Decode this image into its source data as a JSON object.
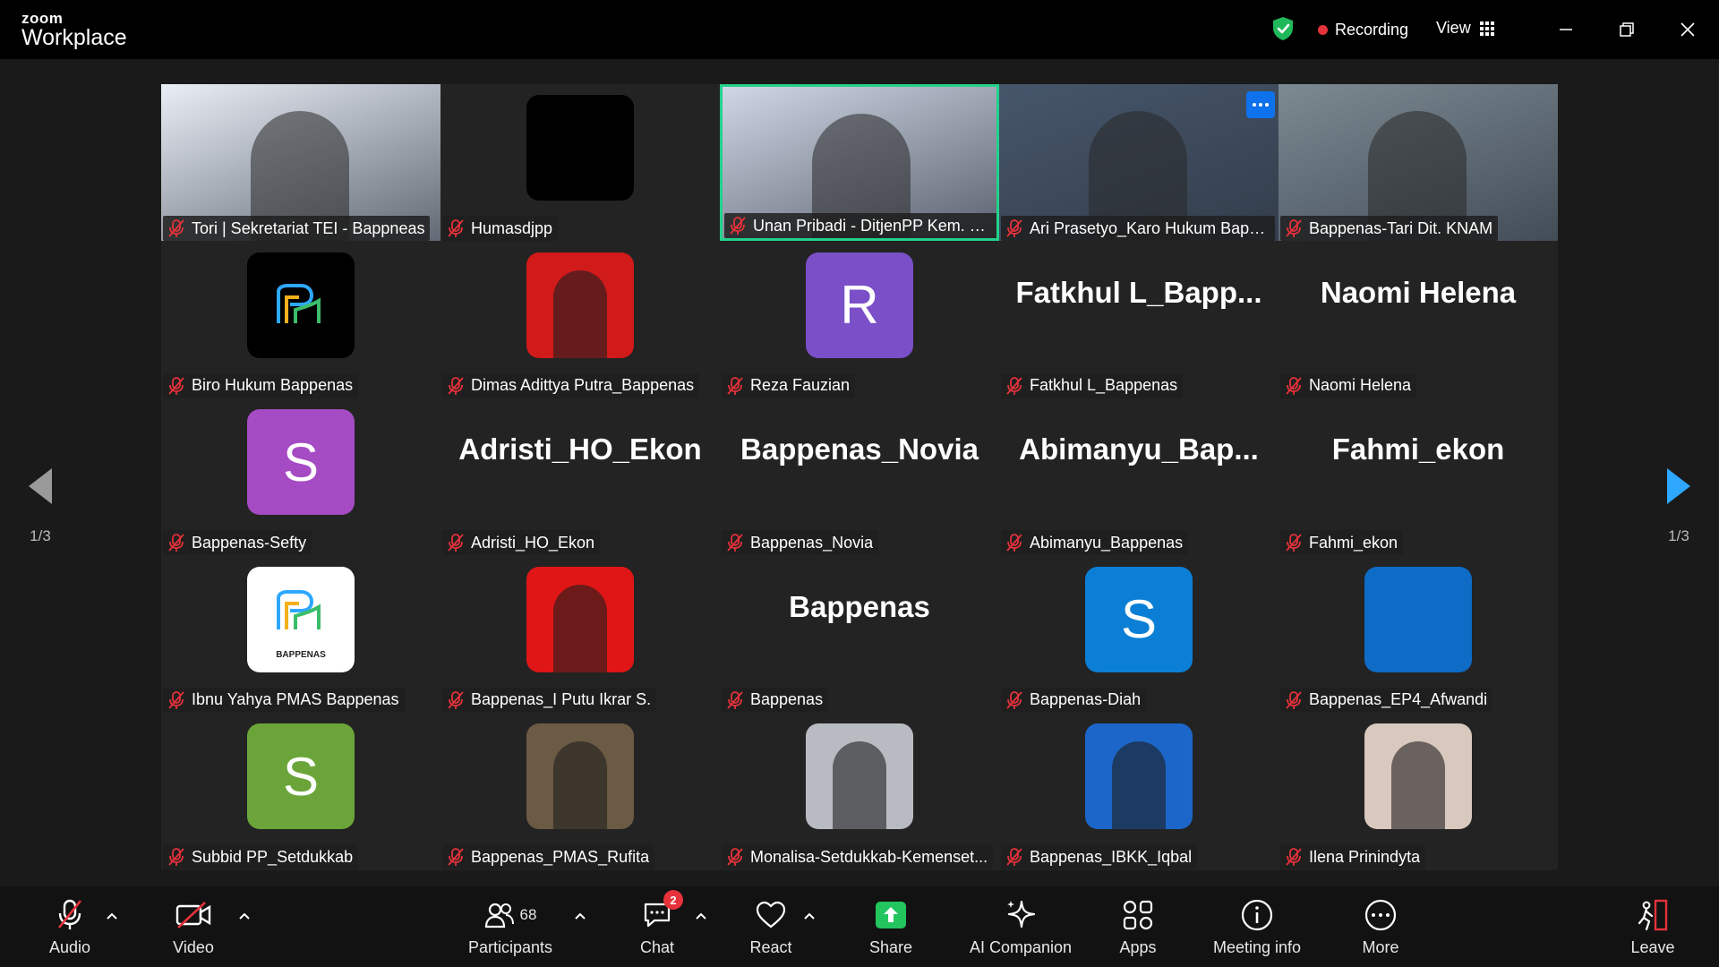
{
  "app": {
    "brand_top": "zoom",
    "brand_bottom": "Workplace"
  },
  "header": {
    "recording_label": "Recording",
    "view_label": "View"
  },
  "pagination": {
    "left": "1/3",
    "right": "1/3"
  },
  "participants": [
    {
      "name": "Tori | Sekretariat TEI - Bappneas",
      "type": "video",
      "bg": "#e9eef6"
    },
    {
      "name": "Humasdjpp",
      "type": "avatar",
      "color": "#000000",
      "letter": ""
    },
    {
      "name": "Unan Pribadi - DitjenPP Kem. Huk...",
      "type": "video",
      "bg": "#cfd7e6",
      "active": true
    },
    {
      "name": "Ari Prasetyo_Karo Hukum Bapp...",
      "type": "video",
      "bg": "#46566a"
    },
    {
      "name": "Bappenas-Tari Dit. KNAM",
      "type": "video",
      "bg": "#7c8a92"
    },
    {
      "name": "Biro Hukum Bappenas",
      "type": "avatar",
      "color": "#000000",
      "letter": "",
      "logo": true
    },
    {
      "name": "Dimas Adittya Putra_Bappenas",
      "type": "avatar",
      "color": "#d11a1a",
      "letter": "",
      "photo": true
    },
    {
      "name": "Reza Fauzian",
      "type": "avatar",
      "color": "#7a4fc7",
      "letter": "R"
    },
    {
      "name": "Fatkhul L_Bappenas",
      "type": "text",
      "bigname": "Fatkhul  L_Bapp..."
    },
    {
      "name": "Naomi Helena",
      "type": "text",
      "bigname": "Naomi Helena"
    },
    {
      "name": "Bappenas-Sefty",
      "type": "avatar",
      "color": "#a54bc3",
      "letter": "S"
    },
    {
      "name": "Adristi_HO_Ekon",
      "type": "text",
      "bigname": "Adristi_HO_Ekon"
    },
    {
      "name": "Bappenas_Novia",
      "type": "text",
      "bigname": "Bappenas_Novia"
    },
    {
      "name": "Abimanyu_Bappenas",
      "type": "text",
      "bigname": "Abimanyu_Bap..."
    },
    {
      "name": "Fahmi_ekon",
      "type": "text",
      "bigname": "Fahmi_ekon"
    },
    {
      "name": "Ibnu Yahya PMAS Bappenas",
      "type": "avatar",
      "color": "#ffffff",
      "letter": "",
      "logo": true,
      "logo_text": "BAPPENAS"
    },
    {
      "name": "Bappenas_I Putu Ikrar S.",
      "type": "avatar",
      "color": "#e01616",
      "letter": "",
      "photo": true
    },
    {
      "name": "Bappenas",
      "type": "text",
      "bigname": "Bappenas"
    },
    {
      "name": "Bappenas-Diah",
      "type": "avatar",
      "color": "#0b7fd6",
      "letter": "S"
    },
    {
      "name": "Bappenas_EP4_Afwandi",
      "type": "avatar",
      "color": "#0e6bc6",
      "letter": ""
    },
    {
      "name": "Subbid PP_Setdukkab",
      "type": "avatar",
      "color": "#6ba53a",
      "letter": "S"
    },
    {
      "name": "Bappenas_PMAS_Rufita",
      "type": "avatar",
      "color": "#6b5a44",
      "letter": "",
      "photo": true
    },
    {
      "name": "Monalisa-Setdukkab-Kemenset...",
      "type": "avatar",
      "color": "#b8bcc2",
      "letter": "",
      "photo": true
    },
    {
      "name": "Bappenas_IBKK_Iqbal",
      "type": "avatar",
      "color": "#1c66c9",
      "letter": "",
      "photo": true
    },
    {
      "name": "Ilena Prinindyta",
      "type": "avatar",
      "color": "#d9c8bd",
      "letter": "",
      "photo": true
    }
  ],
  "toolbar": {
    "audio": "Audio",
    "video": "Video",
    "participants": "Participants",
    "participants_count": "68",
    "chat": "Chat",
    "chat_badge": "2",
    "react": "React",
    "share": "Share",
    "ai": "AI Companion",
    "apps": "Apps",
    "info": "Meeting info",
    "more": "More",
    "leave": "Leave"
  },
  "colors": {
    "share": "#23c55e",
    "active_border": "#23d18b",
    "recording_dot": "#e5323b",
    "shield": "#1fb85a",
    "nav_arrow_right": "#2ea8ff"
  }
}
